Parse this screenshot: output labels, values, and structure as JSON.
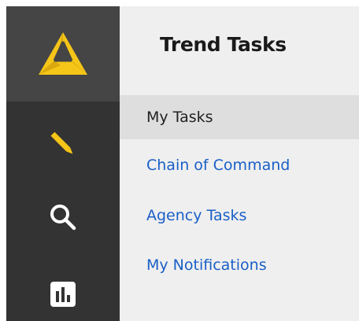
{
  "app": {
    "title": "Trend Tasks"
  },
  "rail": {
    "logo_icon": "triangle-logo-icon",
    "items": [
      {
        "icon": "pencil-icon"
      },
      {
        "icon": "search-icon"
      },
      {
        "icon": "bar-chart-icon"
      }
    ]
  },
  "nav": {
    "items": [
      {
        "label": "My Tasks",
        "active": true
      },
      {
        "label": "Chain of Command",
        "active": false
      },
      {
        "label": "Agency Tasks",
        "active": false
      },
      {
        "label": "My Notifications",
        "active": false
      }
    ]
  },
  "colors": {
    "accent": "#f5c518",
    "link": "#1a5fc7",
    "rail_background": "#333333",
    "logo_background": "#454545",
    "panel_background": "#efefef",
    "active_item_background": "#dedede"
  }
}
